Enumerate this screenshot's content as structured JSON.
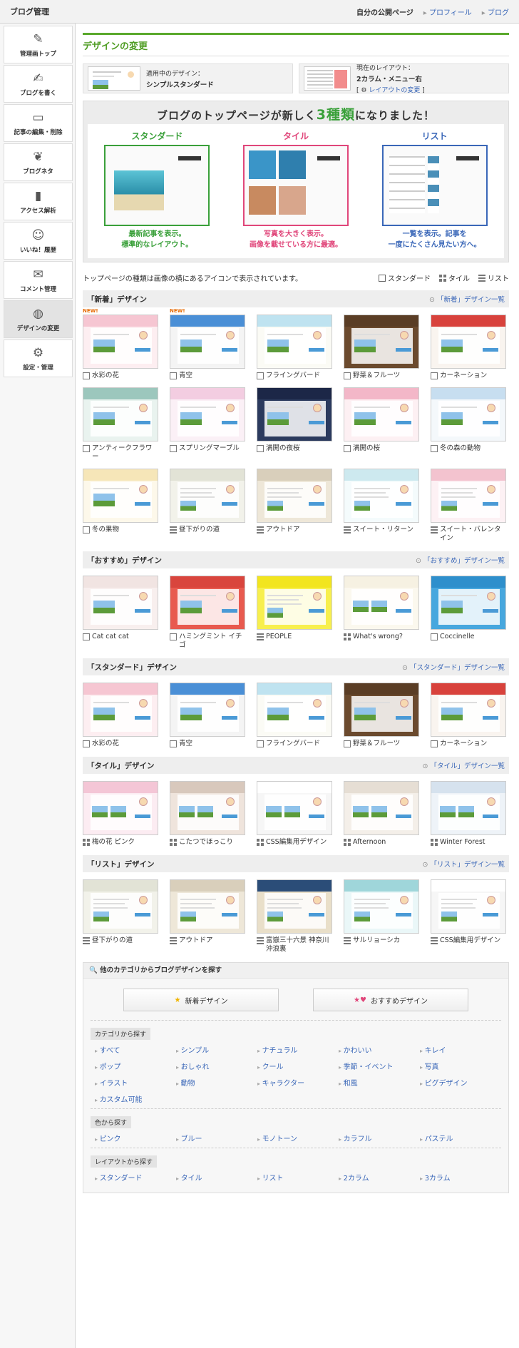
{
  "topbar": {
    "title": "ブログ管理",
    "link_public": "自分の公開ページ",
    "link_profile": "プロフィール",
    "link_blog": "ブログ"
  },
  "sidebar": {
    "items": [
      {
        "label": "管理画トップ",
        "icon": "pencil-icon"
      },
      {
        "label": "ブログを書く",
        "icon": "edit-icon"
      },
      {
        "label": "記事の編集・削除",
        "icon": "folder-icon"
      },
      {
        "label": "ブログネタ",
        "icon": "sprout-icon"
      },
      {
        "label": "アクセス解析",
        "icon": "bar-chart-icon"
      },
      {
        "label": "いいね！履歴",
        "icon": "smile-icon"
      },
      {
        "label": "コメント管理",
        "icon": "comment-icon"
      },
      {
        "label": "デザインの変更",
        "icon": "palette-icon",
        "active": true
      },
      {
        "label": "設定・管理",
        "icon": "gear-icon"
      }
    ]
  },
  "page": {
    "title": "デザインの変更"
  },
  "current": {
    "design_label": "適用中のデザイン：",
    "design_name": "シンプルスタンダード",
    "layout_label": "現在のレイアウト：",
    "layout_name": "2カラム・メニュー右",
    "layout_change": "レイアウトの変更"
  },
  "promo": {
    "headline_pre": "ブログのトップページが新しく",
    "headline_big": "3種類",
    "headline_post": "になりました！",
    "cols": [
      {
        "title": "スタンダード",
        "desc1": "最新記事を表示。",
        "desc2": "標準的なレイアウト。",
        "color": "#3aa03a"
      },
      {
        "title": "タイル",
        "desc1": "写真を大きく表示。",
        "desc2": "画像を載せている方に最適。",
        "color": "#e0467a"
      },
      {
        "title": "リスト",
        "desc1": "一覧を表示。記事を",
        "desc2": "一度にたくさん見たい方へ。",
        "color": "#3a67b8"
      }
    ]
  },
  "legend": {
    "note": "トップページの種類は画像の横にあるアイコンで表示されています。",
    "standard": "スタンダード",
    "tile": "タイル",
    "list": "リスト"
  },
  "sections": [
    {
      "title": "「新着」デザイン",
      "link": "「新着」デザイン一覧",
      "items": [
        {
          "name": "水彩の花",
          "type": "std",
          "badge": "NEW!",
          "c1": "#f6c6d2",
          "c2": "#fdeef1"
        },
        {
          "name": "青空",
          "type": "std",
          "badge": "NEW!",
          "c1": "#4a8fd6",
          "c2": "#f4f4f4"
        },
        {
          "name": "フライングバード",
          "type": "std",
          "c1": "#bfe3f0",
          "c2": "#fbfbf5"
        },
        {
          "name": "野菜＆フルーツ",
          "type": "std",
          "c1": "#5a3d25",
          "c2": "#6b4a2e"
        },
        {
          "name": "カーネーション",
          "type": "std",
          "c1": "#d8423c",
          "c2": "#f9f4ef"
        },
        {
          "name": "アンティークフラワー",
          "type": "std",
          "c1": "#9cc7bd",
          "c2": "#e9f3ef"
        },
        {
          "name": "スプリングマーブル",
          "type": "std",
          "c1": "#f3cde1",
          "c2": "#fbf0f6"
        },
        {
          "name": "満開の夜桜",
          "type": "std",
          "c1": "#1c2747",
          "c2": "#2b3a5e"
        },
        {
          "name": "満開の桜",
          "type": "std",
          "c1": "#f3b7c8",
          "c2": "#fdf0f3"
        },
        {
          "name": "冬の森の動物",
          "type": "std",
          "c1": "#c7def0",
          "c2": "#f4f8fb"
        },
        {
          "name": "冬の果物",
          "type": "std",
          "c1": "#f6e6b8",
          "c2": "#fdf8ea"
        },
        {
          "name": "昼下がりの道",
          "type": "list",
          "c1": "#e2e3d6",
          "c2": "#f2f2ea"
        },
        {
          "name": "アウトドア",
          "type": "list",
          "c1": "#d9cfbb",
          "c2": "#eee7d8"
        },
        {
          "name": "スイート・リターン",
          "type": "list",
          "c1": "#cde9ef",
          "c2": "#f4fbfc"
        },
        {
          "name": "スイート・バレンタイン",
          "type": "list",
          "c1": "#f3c3cf",
          "c2": "#fdf1f4"
        }
      ]
    },
    {
      "title": "「おすすめ」デザイン",
      "link": "「おすすめ」デザイン一覧",
      "items": [
        {
          "name": "Cat cat cat",
          "type": "std",
          "c1": "#f1e4e2",
          "c2": "#f8efee"
        },
        {
          "name": "ハミングミント イチゴ",
          "type": "std",
          "c1": "#d9453d",
          "c2": "#e85a4f"
        },
        {
          "name": "PEOPLE",
          "type": "list",
          "c1": "#f2e51f",
          "c2": "#f7ef4e"
        },
        {
          "name": "What's wrong?",
          "type": "tile",
          "c1": "#f6f1e2",
          "c2": "#fbf8ee"
        },
        {
          "name": "Coccinelle",
          "type": "std",
          "c1": "#2e8fcc",
          "c2": "#47a7de"
        }
      ]
    },
    {
      "title": "「スタンダード」デザイン",
      "link": "「スタンダード」デザイン一覧",
      "items": [
        {
          "name": "水彩の花",
          "type": "std",
          "c1": "#f6c6d2",
          "c2": "#fdeef1"
        },
        {
          "name": "青空",
          "type": "std",
          "c1": "#4a8fd6",
          "c2": "#f4f4f4"
        },
        {
          "name": "フライングバード",
          "type": "std",
          "c1": "#bfe3f0",
          "c2": "#fbfbf5"
        },
        {
          "name": "野菜＆フルーツ",
          "type": "std",
          "c1": "#5a3d25",
          "c2": "#6b4a2e"
        },
        {
          "name": "カーネーション",
          "type": "std",
          "c1": "#d8423c",
          "c2": "#f9f4ef"
        }
      ]
    },
    {
      "title": "「タイル」デザイン",
      "link": "「タイル」デザイン一覧",
      "items": [
        {
          "name": "梅の花 ピンク",
          "type": "tile",
          "c1": "#f4c6d6",
          "c2": "#fcecf2"
        },
        {
          "name": "こたつでほっこり",
          "type": "tile",
          "c1": "#d8c8bc",
          "c2": "#efe4dc"
        },
        {
          "name": "CSS編集用デザイン",
          "type": "tile",
          "c1": "#ffffff",
          "c2": "#f6f6f6"
        },
        {
          "name": "Afternoon",
          "type": "tile",
          "c1": "#e6ded4",
          "c2": "#f4efe9"
        },
        {
          "name": "Winter Forest",
          "type": "tile",
          "c1": "#d6e2ee",
          "c2": "#eef3f8"
        }
      ]
    },
    {
      "title": "「リスト」デザイン",
      "link": "「リスト」デザイン一覧",
      "items": [
        {
          "name": "昼下がりの道",
          "type": "list",
          "c1": "#e2e3d6",
          "c2": "#f2f2ea"
        },
        {
          "name": "アウトドア",
          "type": "list",
          "c1": "#d9cfbb",
          "c2": "#eee7d8"
        },
        {
          "name": "富嶽三十六景 神奈川沖浪裏",
          "type": "list",
          "c1": "#2b4d78",
          "c2": "#e9dfc9"
        },
        {
          "name": "サルリョーシカ",
          "type": "list",
          "c1": "#9fd6da",
          "c2": "#eaf7f8"
        },
        {
          "name": "CSS編集用デザイン",
          "type": "list",
          "c1": "#ffffff",
          "c2": "#f6f6f6"
        }
      ]
    }
  ],
  "other": {
    "title": "他のカテゴリからブログデザインを探す",
    "btn_new": "新着デザイン",
    "btn_recommend": "おすすめデザイン",
    "cat_label": "カテゴリから探す",
    "categories": [
      "すべて",
      "シンプル",
      "ナチュラル",
      "かわいい",
      "キレイ",
      "ポップ",
      "おしゃれ",
      "クール",
      "季節・イベント",
      "写真",
      "イラスト",
      "動物",
      "キャラクター",
      "和風",
      "ピグデザイン",
      "カスタム可能"
    ],
    "color_label": "色から探す",
    "colors": [
      "ピンク",
      "ブルー",
      "モノトーン",
      "カラフル",
      "パステル"
    ],
    "layout_label": "レイアウトから探す",
    "layouts": [
      "スタンダード",
      "タイル",
      "リスト",
      "2カラム",
      "3カラム"
    ]
  }
}
